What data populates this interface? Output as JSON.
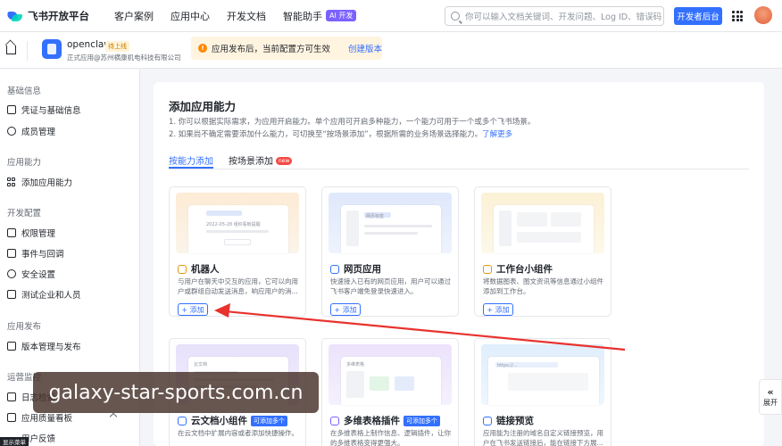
{
  "topnav": {
    "brand": "飞书开放平台",
    "links": [
      "客户案例",
      "应用中心",
      "开发文档",
      "智能助手"
    ],
    "ai_badge": "AI 开发",
    "search_placeholder": "你可以输入文档关键词、开发问题、Log ID、错误码",
    "dev_console": "开发者后台"
  },
  "subhead": {
    "app_name": "openclaw",
    "app_status": "待上线",
    "app_sub": "正式应用@苏州横康机电科技有限公司",
    "notice": "应用发布后，当前配置方可生效",
    "notice_link": "创建版本"
  },
  "sidebar": {
    "groups": [
      {
        "title": "基础信息",
        "items": [
          "凭证与基础信息",
          "成员管理"
        ]
      },
      {
        "title": "应用能力",
        "items": [
          "添加应用能力"
        ]
      },
      {
        "title": "开发配置",
        "items": [
          "权限管理",
          "事件与回调",
          "安全设置",
          "测试企业和人员"
        ]
      },
      {
        "title": "应用发布",
        "items": [
          "版本管理与发布"
        ]
      },
      {
        "title": "运营监控",
        "items": [
          "日志检索",
          "应用质量看板",
          "用户反馈"
        ]
      }
    ],
    "bottom_tag": "显示菜单"
  },
  "main": {
    "title": "添加应用能力",
    "desc1": "1. 你可以根据实际需求，为应用开启能力。单个应用可开启多种能力，一个能力可用于一个或多个飞书场景。",
    "desc2": "2. 如果尚不确定需要添加什么能力，可切换至“按场景添加”，根据所需的业务场景选择能力。",
    "desc2_link": "了解更多",
    "tabs": [
      "按能力添加",
      "按场景添加"
    ],
    "new_badge": "new",
    "add_label": "+ 添加",
    "cards": [
      {
        "title": "机器人",
        "desc": "与用户在聊天中交互的应用，它可以向用户或群组自动发送消息，响应用户的消..."
      },
      {
        "title": "网页应用",
        "desc": "快速接入已有的网页应用，用户可以通过飞书客户端免登录快速进入。"
      },
      {
        "title": "工作台小组件",
        "desc": "将数据图表、图文资讯等信息通过小组件添加到工作台。"
      },
      {
        "title": "云文档小组件",
        "tag": "可添加多个",
        "desc": "在云文档中扩展内容或者添加快捷操作。"
      },
      {
        "title": "多维表格插件",
        "tag": "可添加多个",
        "desc": "在多维表格上制作信息、逻辑插件，让你的多维表格变得更强大。"
      },
      {
        "title": "链接预览",
        "desc": "应用能为注册的域名自定义链接预览，用户在飞书发送链接后，能在链接下方展..."
      }
    ],
    "mock_texts": {
      "bot_chip": "2022-05-28 组织看板",
      "bot_line": "2022-05-28 组织看板提醒",
      "web_tab": "网页标签",
      "doc_head": "云文档",
      "base_head": "多维表格",
      "link_text": "https://..."
    }
  },
  "watermark": "galaxy-star-sports.com.cn",
  "expand_label": "展开"
}
